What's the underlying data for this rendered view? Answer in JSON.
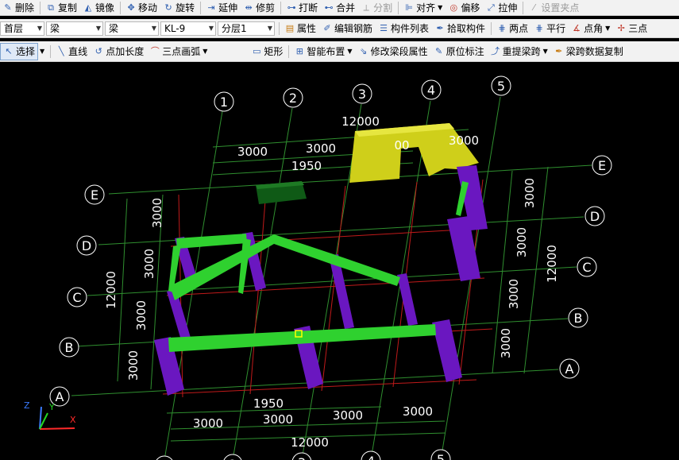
{
  "toolbar1": {
    "items": [
      {
        "label": "删除",
        "icon": "pencil-eraser-icon"
      },
      {
        "label": "复制",
        "icon": "copy-icon"
      },
      {
        "label": "镜像",
        "icon": "mirror-icon"
      },
      {
        "label": "移动",
        "icon": "move-icon"
      },
      {
        "label": "旋转",
        "icon": "rotate-icon"
      },
      {
        "label": "延伸",
        "icon": "extend-icon"
      },
      {
        "label": "修剪",
        "icon": "trim-icon"
      },
      {
        "label": "打断",
        "icon": "break-icon"
      },
      {
        "label": "合并",
        "icon": "merge-icon"
      },
      {
        "label": "分割",
        "icon": "split-icon",
        "disabled": true
      },
      {
        "label": "对齐",
        "icon": "align-icon",
        "dropdown": true
      },
      {
        "label": "偏移",
        "icon": "offset-icon"
      },
      {
        "label": "拉伸",
        "icon": "stretch-icon"
      },
      {
        "label": "设置夹点",
        "icon": "grip-icon",
        "disabled": true
      }
    ]
  },
  "toolbar2": {
    "floor": "首层",
    "category": "梁",
    "type": "梁",
    "component": "KL-9",
    "layer": "分层1",
    "items": [
      {
        "label": "属性",
        "icon": "properties-icon"
      },
      {
        "label": "编辑钢筋",
        "icon": "edit-rebar-icon"
      },
      {
        "label": "构件列表",
        "icon": "component-list-icon"
      },
      {
        "label": "拾取构件",
        "icon": "pick-icon"
      },
      {
        "label": "两点",
        "icon": "two-point-icon"
      },
      {
        "label": "平行",
        "icon": "parallel-icon"
      },
      {
        "label": "点角",
        "icon": "point-angle-icon",
        "dropdown": true
      },
      {
        "label": "三点",
        "icon": "three-point-icon"
      }
    ]
  },
  "toolbar3": {
    "items": [
      {
        "label": "选择",
        "icon": "select-arrow-icon",
        "dropdown": true,
        "active": true
      },
      {
        "label": "直线",
        "icon": "line-icon"
      },
      {
        "label": "点加长度",
        "icon": "point-length-icon"
      },
      {
        "label": "三点画弧",
        "icon": "arc-icon",
        "dropdown": true
      },
      {
        "label": "矩形",
        "icon": "rectangle-icon"
      },
      {
        "label": "智能布置",
        "icon": "smart-layout-icon",
        "dropdown": true
      },
      {
        "label": "修改梁段属性",
        "icon": "modify-beam-icon"
      },
      {
        "label": "原位标注",
        "icon": "in-place-label-icon"
      },
      {
        "label": "重提梁跨",
        "icon": "re-extract-span-icon",
        "dropdown": true
      },
      {
        "label": "梁跨数据复制",
        "icon": "span-copy-icon"
      }
    ]
  },
  "viewport": {
    "axes_numeric": [
      "1",
      "2",
      "3",
      "4",
      "5"
    ],
    "axes_letter": [
      "A",
      "B",
      "C",
      "D",
      "E"
    ],
    "dims": {
      "top_total": "12000",
      "top_spans": [
        "3000",
        "3000",
        "3000"
      ],
      "top_extra": "1950",
      "bottom_total": "12000",
      "bottom_spans": [
        "3000",
        "3000",
        "3000",
        "3000"
      ],
      "bottom_extra": "1950",
      "left_total": "12000",
      "left_spans": [
        "3000",
        "3000",
        "3000",
        "3000"
      ],
      "right_total": "12000",
      "right_spans": [
        "3000",
        "3000",
        "3000",
        "3000"
      ],
      "partial_label": "00"
    },
    "axis_triad": [
      "Z",
      "Y",
      "X"
    ]
  }
}
